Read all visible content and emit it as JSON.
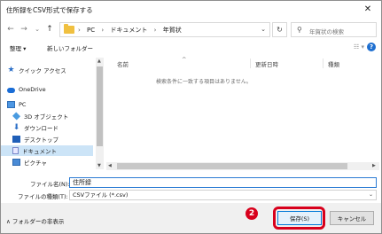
{
  "window": {
    "title": "住所録をCSV形式で保存する",
    "close_label": "✕"
  },
  "address_bar": {
    "back": "←",
    "forward": "→",
    "recent": "⌄",
    "up": "↑",
    "crumbs": [
      "PC",
      "ドキュメント",
      "年賀状"
    ],
    "dropdown": "⌄",
    "refresh": "↻",
    "search_placeholder": "年賀状の検索"
  },
  "toolbar": {
    "organize_label": "整理 ▾",
    "new_folder_label": "新しいフォルダー",
    "view_label": "☷ ▾",
    "help_label": "?"
  },
  "nav": {
    "items": [
      {
        "label": "クイック アクセス",
        "icon": "star-icon"
      },
      {
        "label": "OneDrive",
        "icon": "cloud-icon"
      },
      {
        "label": "PC",
        "icon": "pc-icon"
      },
      {
        "label": "3D オブジェクト",
        "icon": "cube-icon"
      },
      {
        "label": "ダウンロード",
        "icon": "download-icon"
      },
      {
        "label": "デスクトップ",
        "icon": "desktop-icon"
      },
      {
        "label": "ドキュメント",
        "icon": "document-icon"
      },
      {
        "label": "ピクチャ",
        "icon": "picture-icon"
      }
    ]
  },
  "filelist": {
    "columns": [
      "名前",
      "更新日時",
      "種類"
    ],
    "sort_glyph": "^",
    "empty_message": "検索条件に一致する項目はありません。"
  },
  "form": {
    "filename_label": "ファイル名(N):",
    "filename_value": "住所録",
    "filetype_label": "ファイルの種類(T):",
    "filetype_value": "CSVファイル (*.csv)"
  },
  "bottom": {
    "hide_folders_label": "∧  フォルダーの非表示",
    "save_label": "保存(S)",
    "cancel_label": "キャンセル",
    "badge": "2"
  },
  "colors": {
    "accent": "#0078d7",
    "highlight": "#d8001c",
    "selection": "#cce4f7"
  }
}
